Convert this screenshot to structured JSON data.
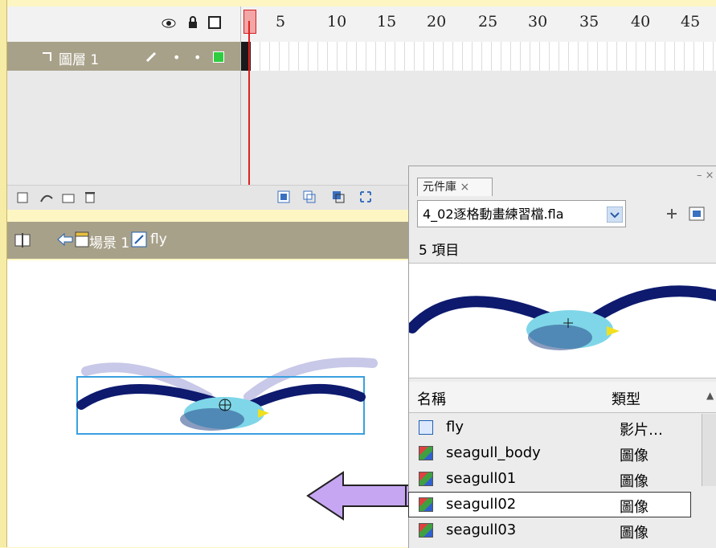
{
  "timeline": {
    "frame_numbers": [
      "5",
      "10",
      "15",
      "20",
      "25",
      "30",
      "35",
      "40",
      "45"
    ],
    "layer_name": "圖層 1"
  },
  "edit_bar": {
    "scene": "場景 1",
    "symbol": "fly"
  },
  "library": {
    "tab_title": "元件庫",
    "file_select": "4_02逐格動畫練習檔.fla",
    "item_count": "5 項目",
    "col_name": "名稱",
    "col_type": "類型",
    "items": [
      {
        "name": "fly",
        "type": "影片…"
      },
      {
        "name": "seagull_body",
        "type": "圖像"
      },
      {
        "name": "seagull01",
        "type": "圖像"
      },
      {
        "name": "seagull02",
        "type": "圖像"
      },
      {
        "name": "seagull03",
        "type": "圖像"
      }
    ]
  },
  "colors": {
    "layer_bar": "#a8a18a",
    "playhead": "#e02020",
    "arrow": "#c6a6f2",
    "stage_selection": "#3aa0e0"
  },
  "icons": [
    "eye-icon",
    "lock-icon",
    "outline-icon",
    "pencil-icon",
    "trash-icon",
    "scene-icon",
    "back-arrow-icon",
    "symbol-icon",
    "graphic-icon"
  ]
}
